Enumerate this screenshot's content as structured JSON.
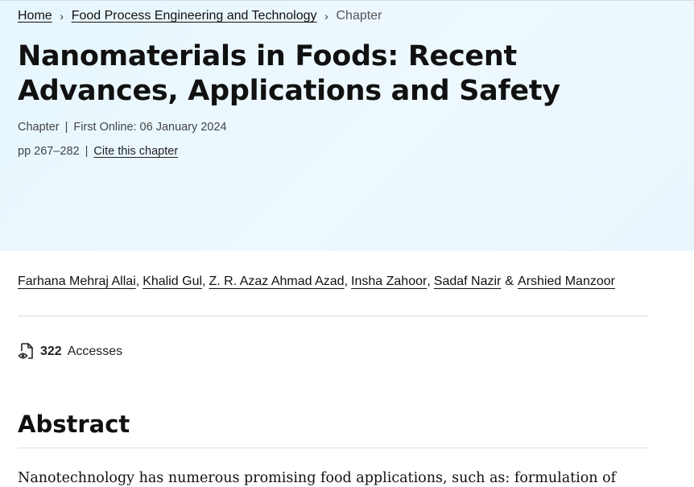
{
  "breadcrumb": {
    "home": "Home",
    "book": "Food Process Engineering and Technology",
    "current": "Chapter",
    "separator": "›"
  },
  "article": {
    "title": "Nanomaterials in Foods: Recent Advances, Applications and Safety",
    "type": "Chapter",
    "first_online": "First Online: 06 January 2024",
    "pages": "pp 267–282",
    "cite_label": "Cite this chapter"
  },
  "authors": {
    "list": [
      "Farhana Mehraj Allai",
      "Khalid Gul",
      "Z. R. Azaz Ahmad Azad",
      "Insha Zahoor",
      "Sadaf Nazir",
      "Arshied Manzoor"
    ],
    "comma": ",",
    "amp": "&"
  },
  "metrics": {
    "accesses_count": "322",
    "accesses_label": "Accesses",
    "icon": "document-eye-icon"
  },
  "abstract": {
    "heading": "Abstract",
    "text": "Nanotechnology has numerous promising food applications, such as: formulation of"
  },
  "colors": {
    "hero_bg": "#eaf7fd",
    "divider": "#d7dfe5",
    "text": "#111111"
  }
}
